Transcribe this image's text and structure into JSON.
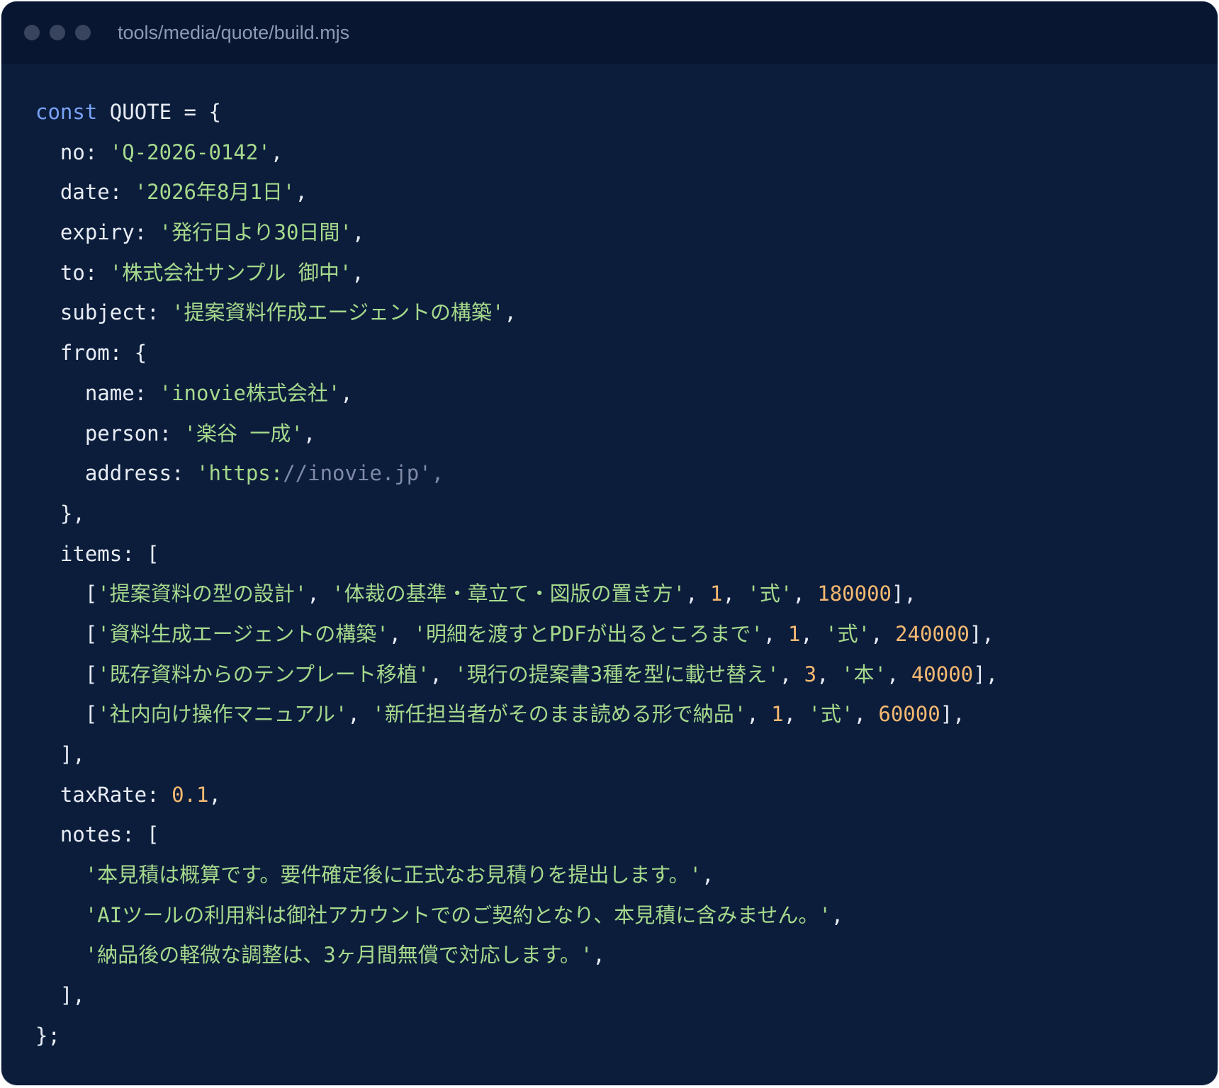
{
  "window": {
    "title": "tools/media/quote/build.mjs",
    "background": "#0b1d3b",
    "titlebar_background": "#081631"
  },
  "colors": {
    "keyword": "#7aa2f7",
    "string": "#a6d98c",
    "number": "#f5b971",
    "faded": "#7f8aa6",
    "plain": "#e8ecf4"
  },
  "code": {
    "decl_keyword": "const",
    "decl_rest": " QUOTE = {",
    "no_key": "  no: ",
    "no_val": "'Q-2026-0142'",
    "date_key": "  date: ",
    "date_val": "'2026年8月1日'",
    "expiry_key": "  expiry: ",
    "expiry_val": "'発行日より30日間'",
    "to_key": "  to: ",
    "to_val": "'株式会社サンプル 御中'",
    "subject_key": "  subject: ",
    "subject_val": "'提案資料作成エージェントの構築'",
    "from_open": "  from: {",
    "name_key": "    name: ",
    "name_val": "'inovie株式会社'",
    "person_key": "    person: ",
    "person_val": "'楽谷 一成'",
    "address_key": "    address: ",
    "address_val_a": "'https:",
    "address_val_b": "//inovie.jp',",
    "from_close": "  },",
    "items_open": "  items: [",
    "items": [
      {
        "name": "'提案資料の型の設計'",
        "desc": "'体裁の基準・章立て・図版の置き方'",
        "qty": "1",
        "unit": "'式'",
        "price": "180000"
      },
      {
        "name": "'資料生成エージェントの構築'",
        "desc": "'明細を渡すとPDFが出るところまで'",
        "qty": "1",
        "unit": "'式'",
        "price": "240000"
      },
      {
        "name": "'既存資料からのテンプレート移植'",
        "desc": "'現行の提案書3種を型に載せ替え'",
        "qty": "3",
        "unit": "'本'",
        "price": "40000"
      },
      {
        "name": "'社内向け操作マニュアル'",
        "desc": "'新任担当者がそのまま読める形で納品'",
        "qty": "1",
        "unit": "'式'",
        "price": "60000"
      }
    ],
    "items_close": "  ],",
    "tax_key": "  taxRate: ",
    "tax_val": "0.1",
    "notes_open": "  notes: [",
    "notes": [
      "'本見積は概算です。要件確定後に正式なお見積りを提出します。'",
      "'AIツールの利用料は御社アカウントでのご契約となり、本見積に含みません。'",
      "'納品後の軽微な調整は、3ヶ月間無償で対応します。'"
    ],
    "notes_close": "  ],",
    "close": "};"
  }
}
